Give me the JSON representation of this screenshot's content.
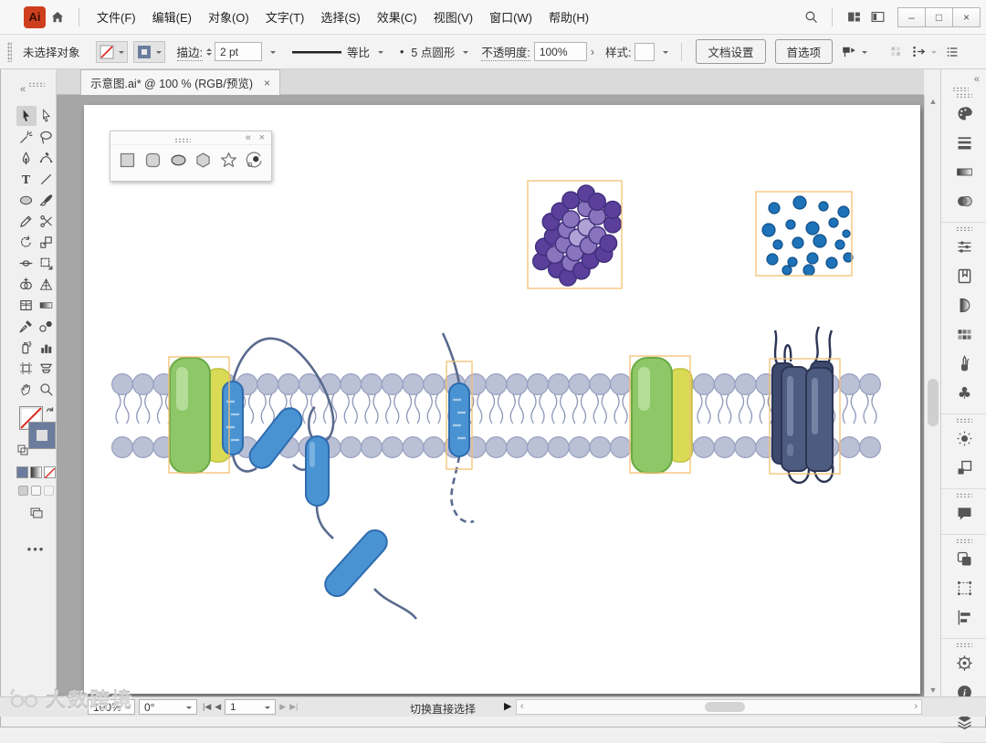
{
  "titlebar": {
    "logo_text": "Ai",
    "menus": [
      "文件(F)",
      "编辑(E)",
      "对象(O)",
      "文字(T)",
      "选择(S)",
      "效果(C)",
      "视图(V)",
      "窗口(W)",
      "帮助(H)"
    ],
    "window_controls": {
      "minimize": "–",
      "maximize": "□",
      "close": "×"
    }
  },
  "control_bar": {
    "selection_status": "未选择对象",
    "stroke_label": "描边:",
    "stroke_width": "2 pt",
    "profile": "等比",
    "brush_bullet": "•",
    "brush_name": "5 点圆形",
    "opacity_label": "不透明度:",
    "opacity_value": "100%",
    "opacity_chevron": "›",
    "style_label": "样式:",
    "document_setup": "文档设置",
    "preferences": "首选项"
  },
  "tab": {
    "title": "示意图.ai* @ 100 % (RGB/预览)",
    "close": "×"
  },
  "left_tools": [
    "selection",
    "direct-selection",
    "magic-wand",
    "lasso",
    "pen",
    "curvature",
    "type",
    "line-segment",
    "ellipse",
    "paintbrush",
    "pencil",
    "scissors",
    "rotate",
    "scale",
    "width",
    "free-transform",
    "shape-builder",
    "perspective-grid",
    "mesh",
    "gradient",
    "eyedropper",
    "blend",
    "symbol-sprayer",
    "column-graph",
    "artboard",
    "slice",
    "hand",
    "zoom"
  ],
  "active_tool": "selection",
  "right_rail_groups": [
    [
      "color",
      "stroke",
      "gradient",
      "transparency"
    ],
    [
      "properties",
      "libraries",
      "appearance",
      "swatches",
      "brushes",
      "symbols"
    ],
    [
      "flare",
      "artboards"
    ],
    [
      "comments"
    ],
    [
      "pathfinder",
      "transform",
      "align"
    ],
    [
      "asset-export",
      "info",
      "layers"
    ]
  ],
  "floating_panel": {
    "shapes": [
      "square",
      "rounded-square",
      "ellipse",
      "hexagon",
      "star",
      "orbit"
    ],
    "collapse": "«",
    "close": "×"
  },
  "status_bar": {
    "zoom_value": "100%",
    "rotation_value": "0°",
    "artboard_value": "1",
    "hint": "切换直接选择"
  },
  "watermark": {
    "text": "大数跨境"
  },
  "rail_collapse": "«",
  "colors": {
    "selection_box": "#f3bf72",
    "membrane_head": "#bac0d6",
    "membrane_head_stroke": "#99a0bf",
    "membrane_tail": "#8f97b8",
    "capsule_blue": "#4a93d2",
    "capsule_blue_stroke": "#2e6cae",
    "capsule_tick": "#a9cdec",
    "capsule_highlight": "#85b9e4",
    "chain_line": "#5a6a8e",
    "protein_green": "#8dc767",
    "protein_green_stroke": "#6aaa44",
    "protein_green_highlight": "#bce0a0",
    "protein_yellow": "#d9da55",
    "protein_yellow_stroke": "#bfc23c",
    "barrel_fill": "#4e5b80",
    "barrel_fill_dark": "#3e4a6d",
    "barrel_stroke": "#2c3554",
    "barrel_highlight": "#7e8aa9",
    "cluster_dark": "#5a3f9b",
    "cluster_mid": "#8a74be",
    "cluster_light": "#b1a1d5",
    "cluster_stroke": "#40307c",
    "dot_fill": "#1d72b8",
    "dot_stroke": "#125089"
  }
}
